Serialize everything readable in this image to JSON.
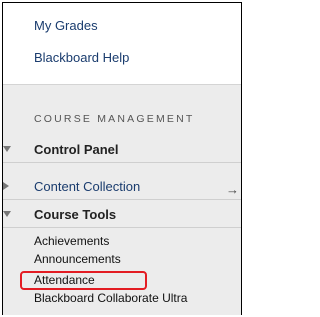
{
  "top_links": [
    "My Grades",
    "Blackboard Help"
  ],
  "course_management": {
    "header": "COURSE MANAGEMENT",
    "control_panel": "Control Panel",
    "content_collection": "Content Collection",
    "content_collection_arrow": "→",
    "course_tools": "Course Tools",
    "tools": [
      "Achievements",
      "Announcements",
      "Attendance",
      "Blackboard Collaborate Ultra"
    ]
  },
  "colors": {
    "highlight": "#e31c23",
    "link": "#1a3c6e"
  },
  "highlighted_item": "Attendance"
}
